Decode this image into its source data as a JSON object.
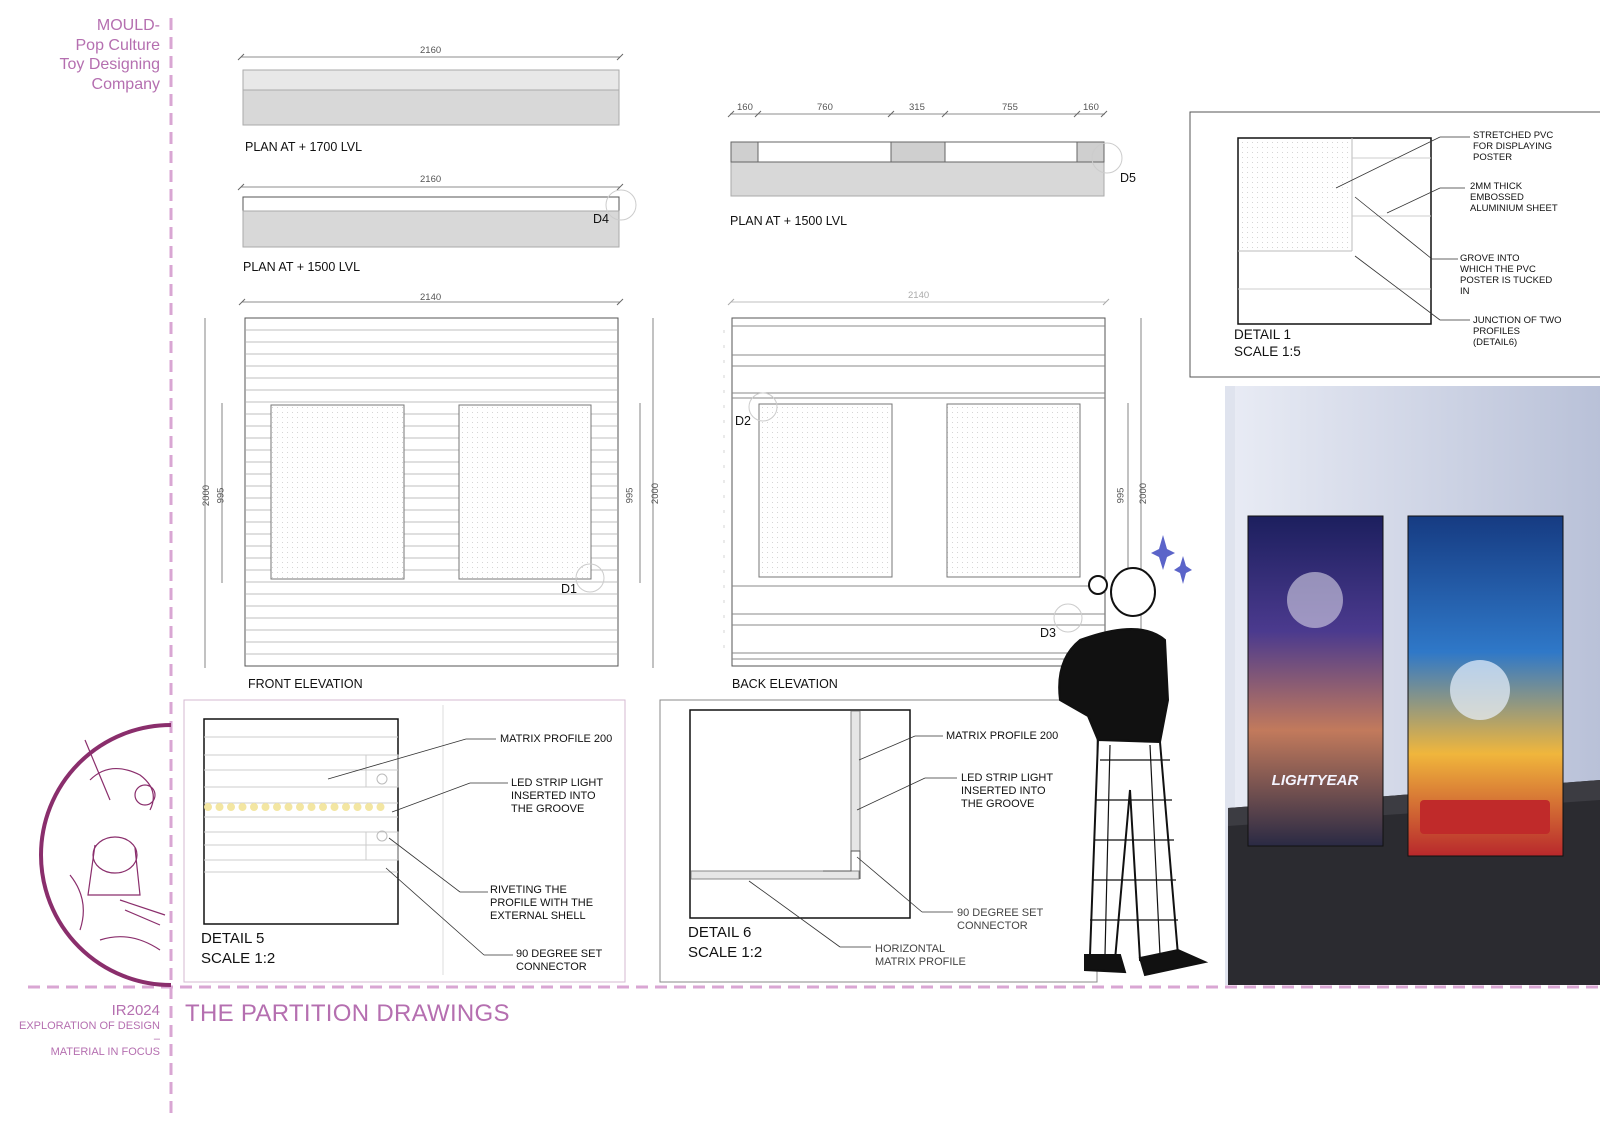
{
  "branding": {
    "line1": "MOULD-",
    "line2": "Pop Culture",
    "line3": "Toy Designing",
    "line4": "Company"
  },
  "footer": {
    "code": "IR2024",
    "line1": "EXPLORATION OF DESIGN",
    "line2": "–",
    "line3": "MATERIAL IN FOCUS"
  },
  "page_title": "THE PARTITION DRAWINGS",
  "plan_1700": {
    "dim": "2160",
    "label": "PLAN AT + 1700 LVL"
  },
  "plan_1500_left": {
    "dim": "2160",
    "label": "PLAN AT + 1500 LVL",
    "marker": "D4"
  },
  "plan_1500_right": {
    "dims": [
      "160",
      "760",
      "315",
      "755",
      "160"
    ],
    "label": "PLAN AT + 1500 LVL",
    "marker": "D5"
  },
  "front_elevation": {
    "width_dim": "2140",
    "height_dim": "2000",
    "panel_dim": "995",
    "label": "FRONT ELEVATION",
    "marker": "D1"
  },
  "back_elevation": {
    "width_dim": "2140",
    "height_dim": "2000",
    "panel_dim": "995",
    "label": "BACK ELEVATION",
    "marker2": "D2",
    "marker3": "D3"
  },
  "detail1": {
    "title": "DETAIL 1",
    "scale": "SCALE 1:5",
    "notes": [
      "STRETCHED PVC\nFOR DISPLAYING\nPOSTER",
      "2MM THICK\nEMBOSSED\nALUMINIUM SHEET",
      "GROVE INTO\nWHICH THE PVC\nPOSTER IS TUCKED\nIN",
      "JUNCTION OF TWO\nPROFILES\n(DETAIL6)"
    ]
  },
  "detail5": {
    "title": "DETAIL 5",
    "scale": "SCALE 1:2",
    "notes": [
      "MATRIX PROFILE 200",
      "LED STRIP LIGHT\nINSERTED INTO\nTHE GROOVE",
      "RIVETING THE\nPROFILE WITH THE\nEXTERNAL SHELL",
      "90 DEGREE SET\nCONNECTOR"
    ]
  },
  "detail6": {
    "title": "DETAIL 6",
    "scale": "SCALE 1:2",
    "notes": [
      "MATRIX PROFILE 200",
      "LED STRIP LIGHT\nINSERTED INTO\nTHE GROOVE",
      "90 DEGREE SET\nCONNECTOR",
      "HORIZONTAL\nMATRIX PROFILE"
    ]
  },
  "colors": {
    "accent": "#b56fb0",
    "dashed_line": "#d9a6d3",
    "plum": "#8a2e6c",
    "star": "#5b64c9"
  }
}
